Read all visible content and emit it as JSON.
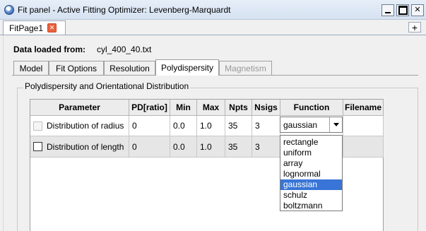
{
  "window": {
    "title": "Fit panel - Active Fitting Optimizer: Levenberg-Marquardt"
  },
  "page_tab": {
    "label": "FitPage1",
    "close_glyph": "✕"
  },
  "add_page_glyph": "+",
  "data_loaded": {
    "label": "Data loaded from:",
    "filename": "cyl_400_40.txt"
  },
  "tabs": [
    {
      "label": "Model"
    },
    {
      "label": "Fit Options"
    },
    {
      "label": "Resolution"
    },
    {
      "label": "Polydispersity",
      "selected": true
    },
    {
      "label": "Magnetism",
      "disabled": true
    }
  ],
  "group_title": "Polydispersity and Orientational Distribution",
  "grid": {
    "columns": [
      "Parameter",
      "PD[ratio]",
      "Min",
      "Max",
      "Npts",
      "Nsigs",
      "Function",
      "Filename"
    ],
    "rows": [
      {
        "parameter": "Distribution of radius",
        "pd": "0",
        "min": "0.0",
        "max": "1.0",
        "npts": "35",
        "nsigs": "3",
        "function": "gaussian",
        "filename": "",
        "checked": false
      },
      {
        "parameter": "Distribution of length",
        "pd": "0",
        "min": "0.0",
        "max": "1.0",
        "npts": "35",
        "nsigs": "3",
        "function": "",
        "filename": "",
        "checked": false
      }
    ]
  },
  "function_dropdown": {
    "selected": "gaussian",
    "options": [
      "rectangle",
      "uniform",
      "array",
      "lognormal",
      "gaussian",
      "schulz",
      "boltzmann"
    ]
  },
  "colors": {
    "selection": "#3875d7",
    "close_tab": "#e8623b"
  }
}
